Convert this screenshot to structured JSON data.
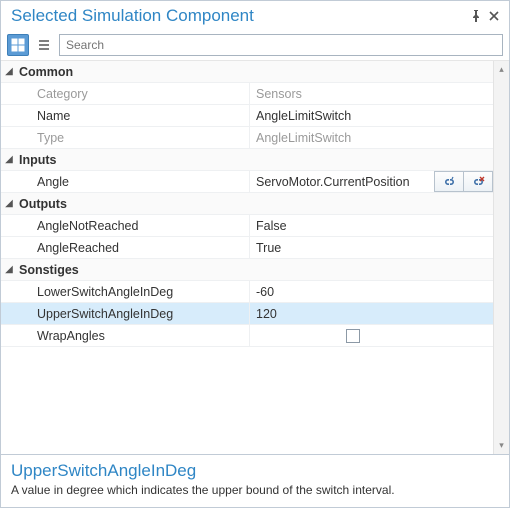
{
  "window": {
    "title": "Selected Simulation Component"
  },
  "search": {
    "placeholder": "Search",
    "value": ""
  },
  "groups": {
    "common": {
      "label": "Common"
    },
    "inputs": {
      "label": "Inputs"
    },
    "outputs": {
      "label": "Outputs"
    },
    "sonstiges": {
      "label": "Sonstiges"
    }
  },
  "props": {
    "category": {
      "label": "Category",
      "value": "Sensors"
    },
    "name": {
      "label": "Name",
      "value": "AngleLimitSwitch"
    },
    "type": {
      "label": "Type",
      "value": "AngleLimitSwitch"
    },
    "angle": {
      "label": "Angle",
      "value": "ServoMotor.CurrentPosition"
    },
    "angleNotReached": {
      "label": "AngleNotReached",
      "value": "False"
    },
    "angleReached": {
      "label": "AngleReached",
      "value": "True"
    },
    "lowerSwitchAngle": {
      "label": "LowerSwitchAngleInDeg",
      "value": "-60"
    },
    "upperSwitchAngle": {
      "label": "UpperSwitchAngleInDeg",
      "value": "120"
    },
    "wrapAngles": {
      "label": "WrapAngles"
    }
  },
  "help": {
    "title": "UpperSwitchAngleInDeg",
    "text": "A value in degree which indicates the upper bound of the switch interval."
  }
}
